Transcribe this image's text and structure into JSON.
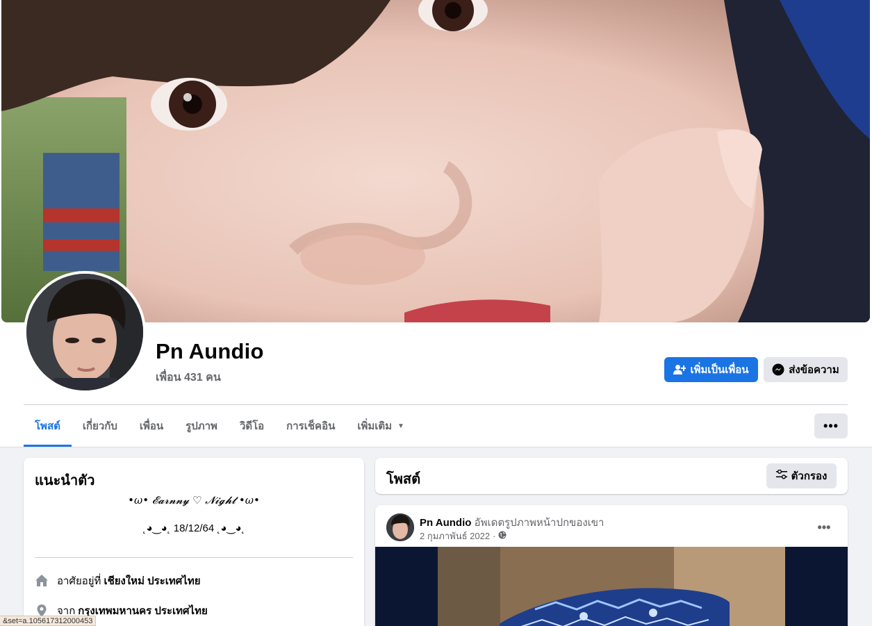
{
  "profile": {
    "name": "Pn Aundio",
    "friends": "เพื่อน 431 คน"
  },
  "actions": {
    "add_friend": "เพิ่มเป็นเพื่อน",
    "message": "ส่งข้อความ"
  },
  "tabs": [
    {
      "label": "โพสต์",
      "active": true
    },
    {
      "label": "เกี่ยวกับ"
    },
    {
      "label": "เพื่อน"
    },
    {
      "label": "รูปภาพ"
    },
    {
      "label": "วิดีโอ"
    },
    {
      "label": "การเช็คอิน"
    },
    {
      "label": "เพิ่มเติม"
    }
  ],
  "more_icon": "•••",
  "intro": {
    "title": "แนะนำตัว",
    "bio_line1": "•ω• 𝓔𝓪𝓻𝓷𝓷𝔂 ♡ 𝓝𝓲𝓰𝓱𝓽 •ω•",
    "bio_line2": "˛◕‿◕˛ 18/12/64 ˛◕‿◕˛",
    "lives_in_prefix": "อาศัยอยู่ที่",
    "lives_in": "เชียงใหม่ ประเทศไทย",
    "from_prefix": "จาก",
    "from": "กรุงเทพมหานคร ประเทศไทย"
  },
  "posts_header": {
    "title": "โพสต์",
    "filter": "ตัวกรอง"
  },
  "post": {
    "author": "Pn Aundio",
    "action": "อัพเดตรูปภาพหน้าปกของเขา",
    "date": "2 กุมภาพันธ์ 2022",
    "separator": "·"
  },
  "status_bar": "&set=a.105617312000453",
  "colors": {
    "accent": "#1b74e4",
    "secondary_button": "#e4e6eb",
    "page_bg": "#f0f2f5",
    "muted_text": "#65676b"
  },
  "icons": {
    "add_friend": "person-plus-icon",
    "message": "messenger-icon",
    "filter": "sliders-icon",
    "home": "home-icon",
    "location": "location-pin-icon",
    "privacy": "globe-icon"
  }
}
